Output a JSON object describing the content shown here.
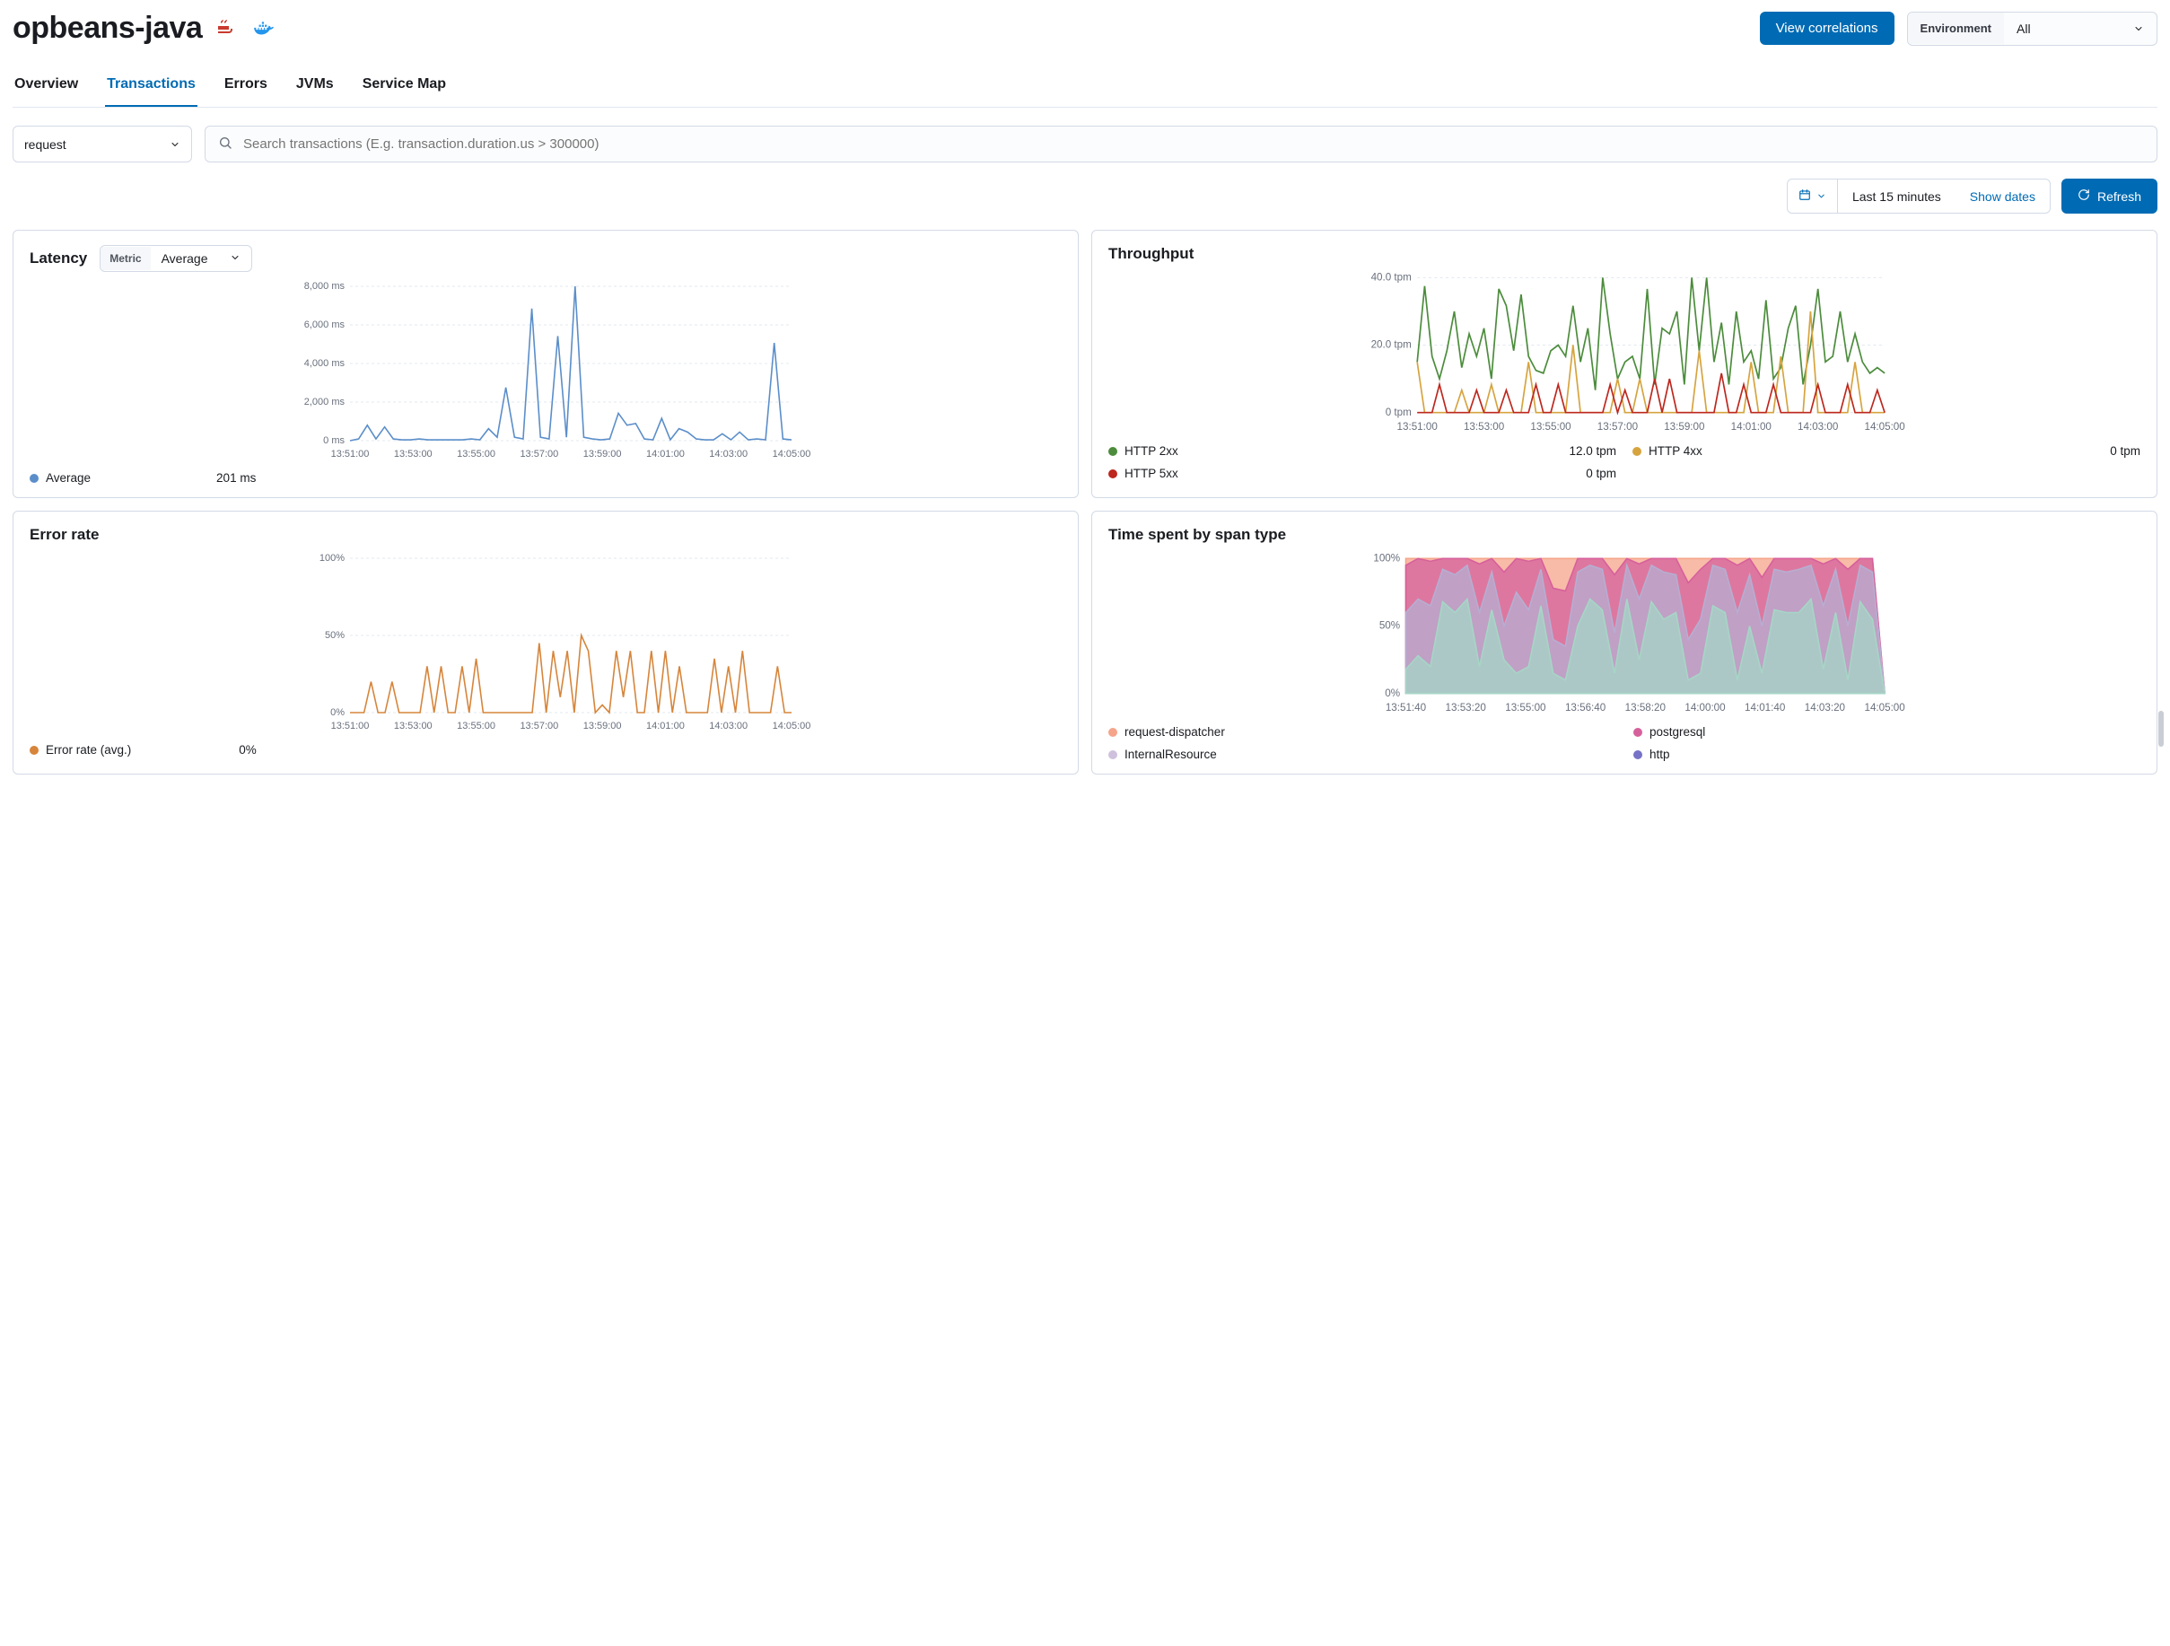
{
  "header": {
    "title": "opbeans-java",
    "correlations_btn": "View correlations",
    "env_label": "Environment",
    "env_value": "All"
  },
  "tabs": [
    "Overview",
    "Transactions",
    "Errors",
    "JVMs",
    "Service Map"
  ],
  "active_tab": 1,
  "filter": {
    "type": "request",
    "search_placeholder": "Search transactions (E.g. transaction.duration.us > 300000)"
  },
  "time": {
    "range_text": "Last 15 minutes",
    "show_dates": "Show dates",
    "refresh": "Refresh"
  },
  "panels": {
    "latency": {
      "title": "Latency",
      "metric_label": "Metric",
      "metric_value": "Average",
      "legend_name": "Average",
      "legend_value": "201 ms"
    },
    "throughput": {
      "title": "Throughput",
      "legend": [
        {
          "name": "HTTP 2xx",
          "value": "12.0 tpm",
          "color": "#4c8c3c"
        },
        {
          "name": "HTTP 4xx",
          "value": "0 tpm",
          "color": "#d6a43f"
        },
        {
          "name": "HTTP 5xx",
          "value": "0 tpm",
          "color": "#bd271e"
        }
      ]
    },
    "error_rate": {
      "title": "Error rate",
      "legend_name": "Error rate (avg.)",
      "legend_value": "0%"
    },
    "span": {
      "title": "Time spent by span type",
      "legend": [
        {
          "name": "request-dispatcher",
          "color": "#f5a48a"
        },
        {
          "name": "postgresql",
          "color": "#d6609c"
        },
        {
          "name": "InternalResource",
          "color": "#cfc1de"
        },
        {
          "name": "http",
          "color": "#7572c7"
        }
      ]
    }
  },
  "chart_data": [
    {
      "id": "latency",
      "type": "line",
      "xlabel": "",
      "ylabel": "",
      "x_ticks": [
        "13:51:00",
        "13:53:00",
        "13:55:00",
        "13:57:00",
        "13:59:00",
        "14:01:00",
        "14:03:00",
        "14:05:00"
      ],
      "y_ticks": [
        "0 ms",
        "2,000 ms",
        "4,000 ms",
        "6,000 ms",
        "8,000 ms"
      ],
      "ylim": [
        0,
        9000
      ],
      "series": [
        {
          "name": "Average",
          "color": "#5b8ec9",
          "values": [
            0,
            100,
            900,
            100,
            800,
            100,
            50,
            50,
            100,
            50,
            50,
            50,
            50,
            50,
            100,
            50,
            700,
            200,
            3100,
            200,
            100,
            7700,
            200,
            100,
            6100,
            200,
            9000,
            200,
            100,
            50,
            100,
            1600,
            900,
            1000,
            100,
            50,
            1300,
            50,
            700,
            500,
            100,
            50,
            50,
            400,
            50,
            500,
            50,
            100,
            50,
            5700,
            100,
            50
          ]
        }
      ]
    },
    {
      "id": "throughput",
      "type": "line",
      "x_ticks": [
        "13:51:00",
        "13:53:00",
        "13:55:00",
        "13:57:00",
        "13:59:00",
        "14:01:00",
        "14:03:00",
        "14:05:00"
      ],
      "y_ticks": [
        "0 tpm",
        "20.0 tpm",
        "40.0 tpm"
      ],
      "ylim": [
        0,
        48
      ],
      "series": [
        {
          "name": "HTTP 2xx",
          "color": "#4c8c3c",
          "values": [
            18,
            45,
            20,
            12,
            22,
            36,
            16,
            28,
            20,
            30,
            12,
            44,
            38,
            22,
            42,
            20,
            15,
            14,
            22,
            24,
            20,
            38,
            18,
            30,
            8,
            48,
            28,
            12,
            18,
            20,
            12,
            44,
            10,
            30,
            28,
            36,
            10,
            48,
            22,
            48,
            18,
            32,
            10,
            36,
            18,
            22,
            12,
            40,
            12,
            16,
            30,
            38,
            10,
            24,
            44,
            18,
            20,
            36,
            18,
            28,
            18,
            14,
            16,
            14
          ]
        },
        {
          "name": "HTTP 4xx",
          "color": "#d6a43f",
          "values": [
            18,
            0,
            0,
            0,
            0,
            0,
            8,
            0,
            0,
            0,
            10,
            0,
            0,
            0,
            0,
            18,
            0,
            0,
            0,
            0,
            0,
            24,
            0,
            0,
            0,
            0,
            0,
            12,
            0,
            0,
            12,
            0,
            0,
            0,
            0,
            0,
            0,
            0,
            22,
            0,
            0,
            0,
            0,
            0,
            0,
            18,
            0,
            0,
            0,
            20,
            0,
            0,
            0,
            36,
            0,
            0,
            0,
            0,
            0,
            18,
            0,
            0,
            0,
            0
          ]
        },
        {
          "name": "HTTP 5xx",
          "color": "#bd271e",
          "values": [
            0,
            0,
            0,
            10,
            0,
            0,
            0,
            0,
            8,
            0,
            0,
            0,
            8,
            0,
            0,
            0,
            10,
            0,
            0,
            10,
            0,
            0,
            0,
            0,
            0,
            0,
            10,
            0,
            8,
            0,
            0,
            0,
            12,
            0,
            12,
            0,
            0,
            0,
            0,
            0,
            0,
            14,
            0,
            0,
            10,
            0,
            0,
            0,
            10,
            0,
            0,
            0,
            0,
            0,
            10,
            0,
            0,
            0,
            10,
            0,
            0,
            0,
            8,
            0
          ]
        }
      ]
    },
    {
      "id": "error_rate",
      "type": "line",
      "x_ticks": [
        "13:51:00",
        "13:53:00",
        "13:55:00",
        "13:57:00",
        "13:59:00",
        "14:01:00",
        "14:03:00",
        "14:05:00"
      ],
      "y_ticks": [
        "0%",
        "50%",
        "100%"
      ],
      "ylim": [
        0,
        100
      ],
      "series": [
        {
          "name": "Error rate (avg.)",
          "color": "#d6853b",
          "values": [
            0,
            0,
            0,
            20,
            0,
            0,
            20,
            0,
            0,
            0,
            0,
            30,
            0,
            30,
            0,
            0,
            30,
            0,
            35,
            0,
            0,
            0,
            0,
            0,
            0,
            0,
            0,
            45,
            0,
            40,
            10,
            40,
            0,
            50,
            40,
            0,
            5,
            0,
            40,
            10,
            40,
            0,
            0,
            40,
            0,
            40,
            0,
            30,
            0,
            0,
            0,
            0,
            35,
            0,
            30,
            0,
            40,
            0,
            0,
            0,
            0,
            30,
            0,
            0
          ]
        }
      ]
    },
    {
      "id": "span",
      "type": "area",
      "x_ticks": [
        "13:51:40",
        "13:53:20",
        "13:55:00",
        "13:56:40",
        "13:58:20",
        "14:00:00",
        "14:01:40",
        "14:03:20",
        "14:05:00"
      ],
      "y_ticks": [
        "0%",
        "50%",
        "100%"
      ],
      "ylim": [
        0,
        100
      ],
      "series": [
        {
          "name": "http",
          "color": "#a6d6c6",
          "values": [
            18,
            28,
            20,
            68,
            60,
            70,
            20,
            62,
            25,
            15,
            20,
            65,
            15,
            10,
            50,
            70,
            62,
            15,
            70,
            25,
            68,
            55,
            60,
            10,
            15,
            65,
            60,
            10,
            50,
            15,
            62,
            60,
            60,
            70,
            18,
            60,
            10,
            68,
            55,
            0
          ]
        },
        {
          "name": "InternalResource",
          "color": "#b6aed2",
          "values": [
            60,
            70,
            65,
            92,
            88,
            95,
            60,
            90,
            50,
            75,
            62,
            92,
            40,
            35,
            90,
            95,
            92,
            45,
            95,
            70,
            95,
            90,
            88,
            40,
            55,
            95,
            92,
            60,
            88,
            50,
            92,
            90,
            92,
            95,
            65,
            92,
            50,
            95,
            90,
            0
          ]
        },
        {
          "name": "postgresql",
          "color": "#d6609c",
          "values": [
            95,
            100,
            98,
            100,
            100,
            100,
            96,
            100,
            90,
            100,
            98,
            100,
            78,
            76,
            100,
            100,
            100,
            88,
            100,
            96,
            100,
            100,
            100,
            82,
            92,
            100,
            100,
            95,
            100,
            86,
            100,
            100,
            100,
            100,
            96,
            100,
            92,
            100,
            100,
            0
          ]
        },
        {
          "name": "request-dispatcher",
          "color": "#f5a48a",
          "values": [
            100,
            100,
            100,
            100,
            100,
            100,
            100,
            100,
            100,
            100,
            100,
            100,
            100,
            100,
            100,
            100,
            100,
            100,
            100,
            100,
            100,
            100,
            100,
            100,
            100,
            100,
            100,
            100,
            100,
            100,
            100,
            100,
            100,
            100,
            100,
            100,
            100,
            100,
            100,
            0
          ]
        }
      ]
    }
  ]
}
